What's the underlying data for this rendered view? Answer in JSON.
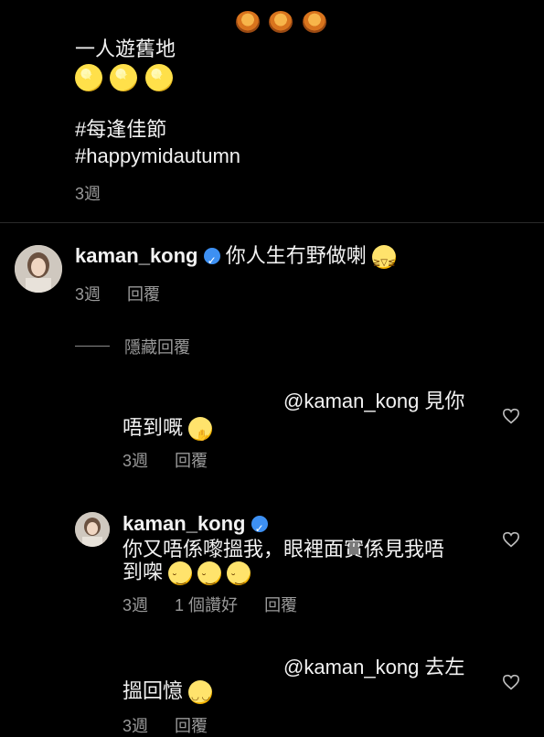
{
  "post": {
    "lines": [
      "一人遊舊地",
      "#每逢佳節",
      "#happymidautumn"
    ],
    "time": "3週",
    "emojis_top": [
      "mooncake",
      "mooncake",
      "mooncake"
    ],
    "emojis_moons": [
      "full-moon",
      "full-moon",
      "full-moon"
    ]
  },
  "comment1": {
    "username": "kaman_kong",
    "text": "你人生冇野做喇",
    "time": "3週",
    "reply_label": "回覆",
    "hide_replies": "隱藏回覆"
  },
  "reply1": {
    "mention": "@kaman_kong 見你",
    "text": "唔到嘅",
    "time": "3週",
    "reply_label": "回覆"
  },
  "reply2": {
    "username": "kaman_kong",
    "line1": "你又唔係嚟搵我，眼裡面實係見我唔",
    "line2": "到㗎",
    "time": "3週",
    "likes": "1 個讚好",
    "reply_label": "回覆"
  },
  "reply3": {
    "mention": "@kaman_kong 去左",
    "text": "搵回憶",
    "time": "3週",
    "reply_label": "回覆"
  }
}
